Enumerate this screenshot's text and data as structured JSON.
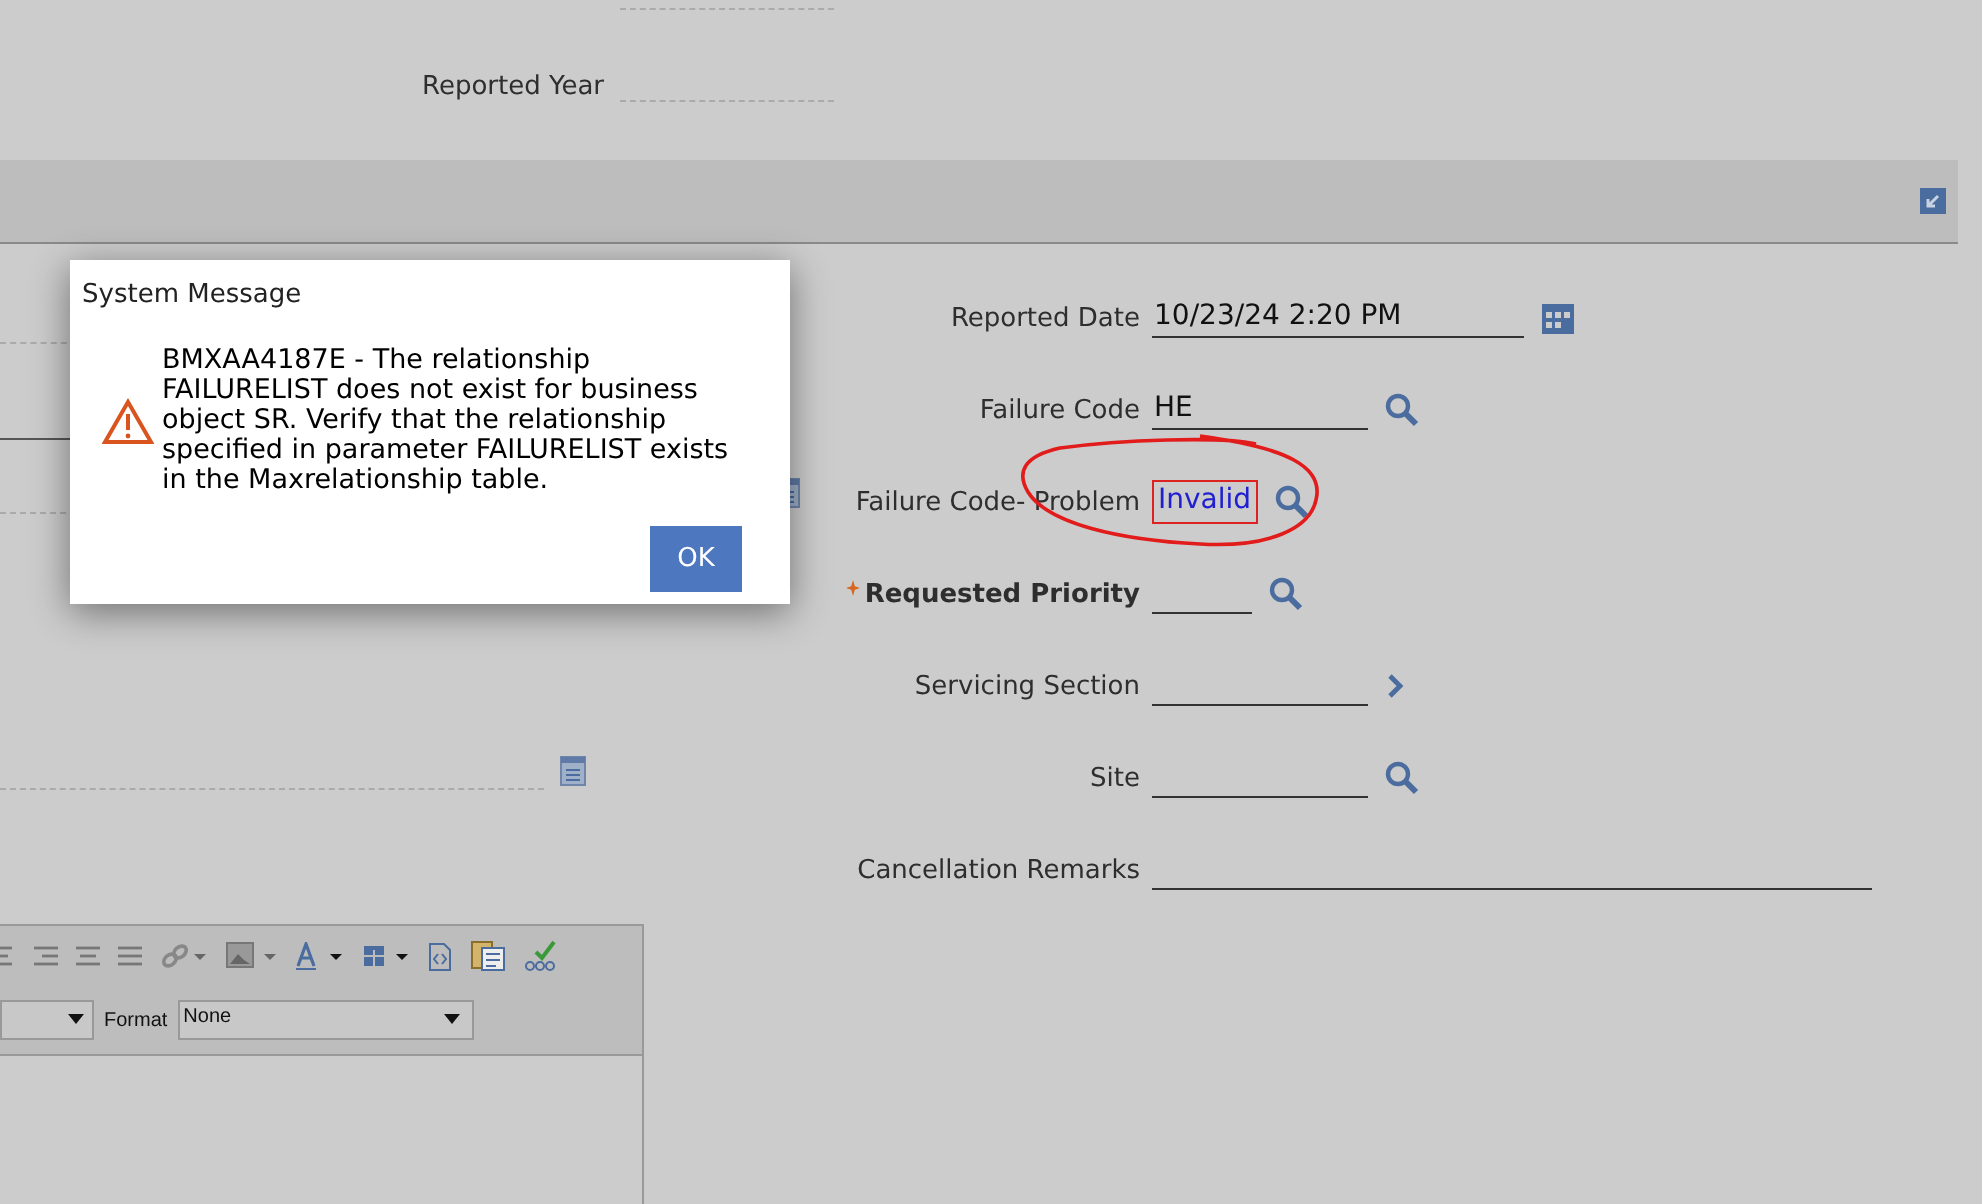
{
  "top_fields": [
    {
      "label": "Reported Year"
    }
  ],
  "form": {
    "fields": [
      {
        "kind": "date",
        "label": "Reported Date",
        "value": "10/23/24 2:20 PM",
        "required": false,
        "invalid": false
      },
      {
        "kind": "lookup",
        "label": "Failure Code",
        "value": "HE",
        "required": false,
        "invalid": false
      },
      {
        "kind": "lookup",
        "label": "Failure Code- Problem",
        "value": "Invalid",
        "required": false,
        "invalid": true
      },
      {
        "kind": "lookup",
        "label": "Requested Priority",
        "required": true,
        "invalid": false
      },
      {
        "kind": "menu",
        "label": "Servicing Section",
        "required": false,
        "invalid": false
      },
      {
        "kind": "lookup",
        "label": "Site",
        "required": false,
        "invalid": false
      },
      {
        "kind": "text",
        "label": "Cancellation Remarks",
        "required": false,
        "invalid": false
      }
    ]
  },
  "editor": {
    "format_label": "Format",
    "format_value": "None"
  },
  "dialog": {
    "title": "System Message",
    "message": "BMXAA4187E - The relationship FAILURELIST does not exist for business object SR. Verify that the relationship specified in parameter FAILURELIST exists in the Maxrelationship table.",
    "buttons": [
      "OK"
    ]
  }
}
